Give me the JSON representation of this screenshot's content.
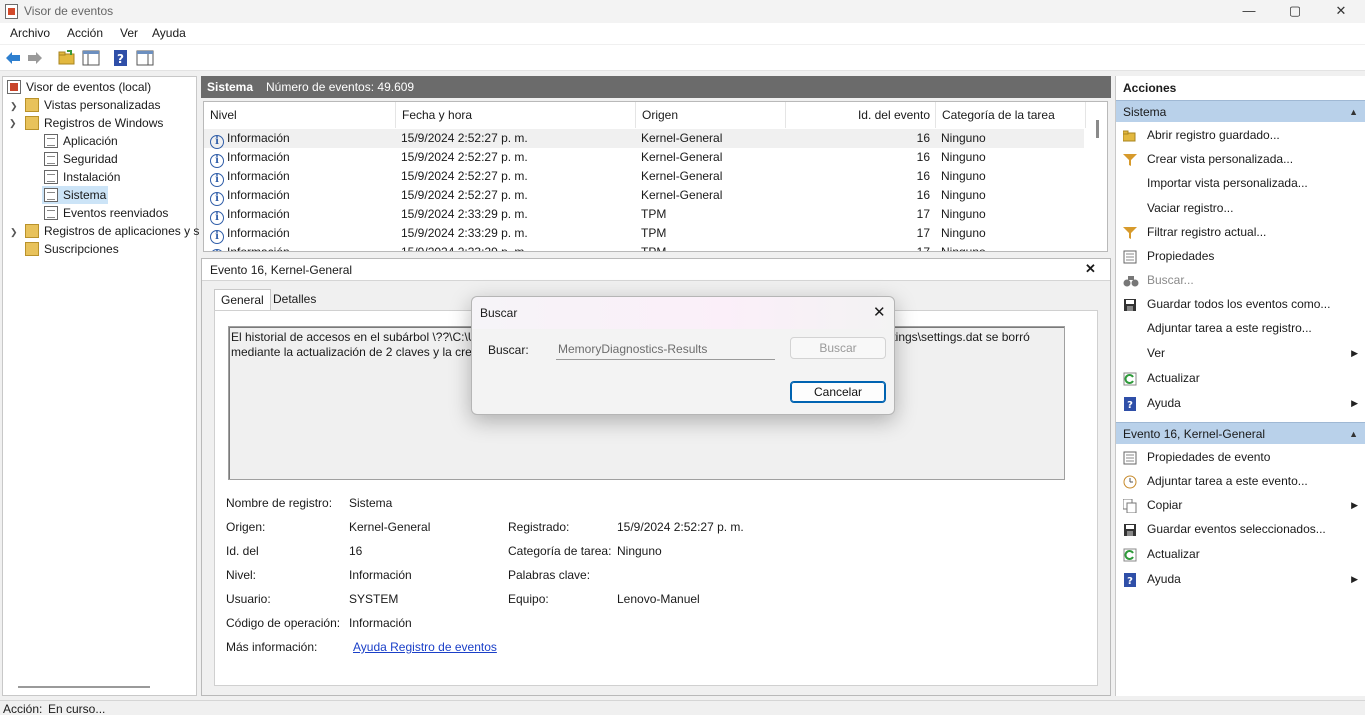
{
  "window": {
    "title": "Visor de eventos",
    "controls": {
      "minimize": "—",
      "maximize": "▢",
      "close": "✕"
    }
  },
  "menubar": [
    "Archivo",
    "Acción",
    "Ver",
    "Ayuda"
  ],
  "toolbar": {
    "icons": [
      "back-arrow-icon",
      "forward-arrow-icon",
      "open-folder-icon",
      "panel-icon",
      "help-icon",
      "panel2-icon"
    ]
  },
  "tree": {
    "root": "Visor de eventos (local)",
    "custom_views": "Vistas personalizadas",
    "windows_logs": "Registros de Windows",
    "logs": [
      "Aplicación",
      "Seguridad",
      "Instalación",
      "Sistema",
      "Eventos reenviados"
    ],
    "apps_logs": "Registros de aplicaciones y s",
    "subscriptions": "Suscripciones"
  },
  "center": {
    "log_name": "Sistema",
    "event_count": "Número de eventos: 49.609",
    "columns": [
      "Nivel",
      "Fecha y hora",
      "Origen",
      "Id. del evento",
      "Categoría de la tarea"
    ],
    "rows": [
      {
        "level": "Información",
        "date": "15/9/2024 2:52:27 p. m.",
        "source": "Kernel-General",
        "id": "16",
        "category": "Ninguno"
      },
      {
        "level": "Información",
        "date": "15/9/2024 2:52:27 p. m.",
        "source": "Kernel-General",
        "id": "16",
        "category": "Ninguno"
      },
      {
        "level": "Información",
        "date": "15/9/2024 2:52:27 p. m.",
        "source": "Kernel-General",
        "id": "16",
        "category": "Ninguno"
      },
      {
        "level": "Información",
        "date": "15/9/2024 2:52:27 p. m.",
        "source": "Kernel-General",
        "id": "16",
        "category": "Ninguno"
      },
      {
        "level": "Información",
        "date": "15/9/2024 2:33:29 p. m.",
        "source": "TPM",
        "id": "17",
        "category": "Ninguno"
      },
      {
        "level": "Información",
        "date": "15/9/2024 2:33:29 p. m.",
        "source": "TPM",
        "id": "17",
        "category": "Ninguno"
      },
      {
        "level": "Información",
        "date": "15/9/2024 2:33:29 p. m.",
        "source": "TPM",
        "id": "17",
        "category": "Ninguno"
      }
    ]
  },
  "detail": {
    "title": "Evento 16, Kernel-General",
    "close": "✕",
    "tabs": [
      "General",
      "Detalles"
    ],
    "description_line1_left": "El historial de accesos en el subárbol \\??\\C:\\Us",
    "description_line1_right": "ttings\\settings.dat se borró",
    "description_line2": "mediante la actualización de 2 claves y la crea",
    "fields": {
      "log_name_label": "Nombre de registro:",
      "log_name": "Sistema",
      "source_label": "Origen:",
      "source": "Kernel-General",
      "logged_label": "Registrado:",
      "logged": "15/9/2024 2:52:27 p. m.",
      "event_id_label": "Id. del",
      "event_id": "16",
      "task_category_label": "Categoría de tarea:",
      "task_category": "Ninguno",
      "level_label": "Nivel:",
      "level": "Información",
      "keywords_label": "Palabras clave:",
      "keywords": "",
      "user_label": "Usuario:",
      "user": "SYSTEM",
      "computer_label": "Equipo:",
      "computer": "Lenovo-Manuel",
      "opcode_label": "Código de operación:",
      "opcode": "Información",
      "more_info_label": "Más información:",
      "more_info_link": "Ayuda Registro de eventos"
    }
  },
  "actions": {
    "title": "Acciones",
    "section1": "Sistema",
    "section1_items": [
      {
        "label": "Abrir registro guardado...",
        "icon": "open-folder-icon",
        "disabled": false,
        "submenu": false
      },
      {
        "label": "Crear vista personalizada...",
        "icon": "filter-icon",
        "disabled": false,
        "submenu": false
      },
      {
        "label": "Importar vista personalizada...",
        "icon": "",
        "disabled": false,
        "submenu": false
      },
      {
        "label": "Vaciar registro...",
        "icon": "",
        "disabled": false,
        "submenu": false
      },
      {
        "label": "Filtrar registro actual...",
        "icon": "filter-icon",
        "disabled": false,
        "submenu": false
      },
      {
        "label": "Propiedades",
        "icon": "properties-icon",
        "disabled": false,
        "submenu": false
      },
      {
        "label": "Buscar...",
        "icon": "binoculars-icon",
        "disabled": true,
        "submenu": false
      },
      {
        "label": "Guardar todos los eventos como...",
        "icon": "save-icon",
        "disabled": false,
        "submenu": false
      },
      {
        "label": "Adjuntar tarea a este registro...",
        "icon": "",
        "disabled": false,
        "submenu": false
      },
      {
        "label": "Ver",
        "icon": "",
        "disabled": false,
        "submenu": true
      },
      {
        "label": "Actualizar",
        "icon": "refresh-icon",
        "disabled": false,
        "submenu": false
      },
      {
        "label": "Ayuda",
        "icon": "help-icon",
        "disabled": false,
        "submenu": true
      }
    ],
    "section2": "Evento 16, Kernel-General",
    "section2_items": [
      {
        "label": "Propiedades de evento",
        "icon": "properties-icon",
        "disabled": false,
        "submenu": false
      },
      {
        "label": "Adjuntar tarea a este evento...",
        "icon": "task-icon",
        "disabled": false,
        "submenu": false
      },
      {
        "label": "Copiar",
        "icon": "copy-icon",
        "disabled": false,
        "submenu": true
      },
      {
        "label": "Guardar eventos seleccionados...",
        "icon": "save-icon",
        "disabled": false,
        "submenu": false
      },
      {
        "label": "Actualizar",
        "icon": "refresh-icon",
        "disabled": false,
        "submenu": false
      },
      {
        "label": "Ayuda",
        "icon": "help-icon",
        "disabled": false,
        "submenu": true
      }
    ]
  },
  "status": {
    "label": "Acción:",
    "text": "En curso..."
  },
  "dialog": {
    "title": "Buscar",
    "find_label": "Buscar:",
    "find_value": "MemoryDiagnostics-Results",
    "find_button": "Buscar",
    "cancel_button": "Cancelar",
    "close": "✕"
  }
}
